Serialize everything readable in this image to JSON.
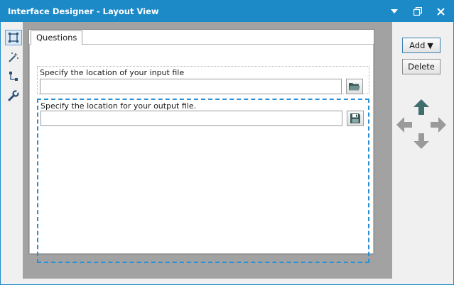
{
  "window": {
    "title": "Interface Designer - Layout View",
    "accent_color": "#1d8ac8"
  },
  "title_controls": {
    "dropdown_icon": "chevron-down-icon",
    "restore_icon": "restore-icon",
    "close_icon": "close-icon"
  },
  "left_toolbar": {
    "tools": [
      {
        "icon": "layout-select-icon",
        "active": true
      },
      {
        "icon": "magic-wand-icon",
        "active": false
      },
      {
        "icon": "tree-hierarchy-icon",
        "active": false
      },
      {
        "icon": "wrench-icon",
        "active": false
      }
    ]
  },
  "design": {
    "tab_label": "Questions",
    "questions": [
      {
        "label": "Specify the location of your input file",
        "value": "",
        "button_icon": "folder-open-icon"
      },
      {
        "label": "Specify the location for your output file.",
        "value": "",
        "button_icon": "save-disk-icon"
      }
    ]
  },
  "right_panel": {
    "add_label": "Add",
    "add_caret": "▼",
    "delete_label": "Delete",
    "move_icons": [
      "arrow-up-icon",
      "arrow-left-icon",
      "arrow-right-icon",
      "arrow-down-icon"
    ],
    "move_up_color": "#3f6e6e",
    "move_disabled_color": "#9a9a9a"
  }
}
